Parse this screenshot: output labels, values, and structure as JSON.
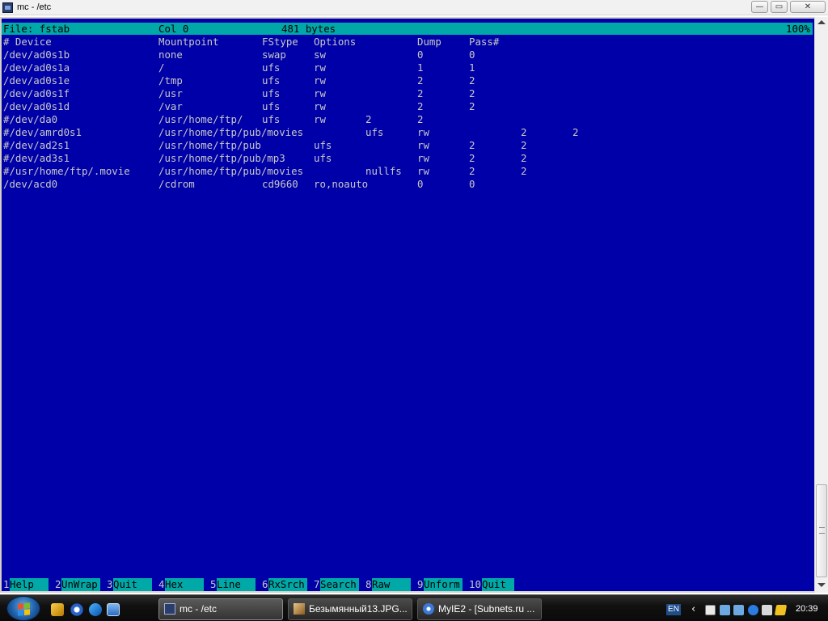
{
  "window": {
    "title": "mc - /etc",
    "minimize_glyph": "—",
    "maximize_glyph": "▭",
    "close_glyph": "✕"
  },
  "status": {
    "file": "File: fstab",
    "col": "Col 0",
    "size": "481 bytes",
    "percent": "100%"
  },
  "fstab": {
    "rows": [
      {
        "cells": [
          {
            "t": "# Device",
            "c": 0
          },
          {
            "t": "Mountpoint",
            "c": 24
          },
          {
            "t": "FStype",
            "c": 40
          },
          {
            "t": "Options",
            "c": 48
          },
          {
            "t": "Dump",
            "c": 64
          },
          {
            "t": "Pass#",
            "c": 72
          }
        ]
      },
      {
        "cells": [
          {
            "t": "/dev/ad0s1b",
            "c": 0
          },
          {
            "t": "none",
            "c": 24
          },
          {
            "t": "swap",
            "c": 40
          },
          {
            "t": "sw",
            "c": 48
          },
          {
            "t": "0",
            "c": 64
          },
          {
            "t": "0",
            "c": 72
          }
        ]
      },
      {
        "cells": [
          {
            "t": "/dev/ad0s1a",
            "c": 0
          },
          {
            "t": "/",
            "c": 24
          },
          {
            "t": "ufs",
            "c": 40
          },
          {
            "t": "rw",
            "c": 48
          },
          {
            "t": "1",
            "c": 64
          },
          {
            "t": "1",
            "c": 72
          }
        ]
      },
      {
        "cells": [
          {
            "t": "/dev/ad0s1e",
            "c": 0
          },
          {
            "t": "/tmp",
            "c": 24
          },
          {
            "t": "ufs",
            "c": 40
          },
          {
            "t": "rw",
            "c": 48
          },
          {
            "t": "2",
            "c": 64
          },
          {
            "t": "2",
            "c": 72
          }
        ]
      },
      {
        "cells": [
          {
            "t": "/dev/ad0s1f",
            "c": 0
          },
          {
            "t": "/usr",
            "c": 24
          },
          {
            "t": "ufs",
            "c": 40
          },
          {
            "t": "rw",
            "c": 48
          },
          {
            "t": "2",
            "c": 64
          },
          {
            "t": "2",
            "c": 72
          }
        ]
      },
      {
        "cells": [
          {
            "t": "/dev/ad0s1d",
            "c": 0
          },
          {
            "t": "/var",
            "c": 24
          },
          {
            "t": "ufs",
            "c": 40
          },
          {
            "t": "rw",
            "c": 48
          },
          {
            "t": "2",
            "c": 64
          },
          {
            "t": "2",
            "c": 72
          }
        ]
      },
      {
        "cells": [
          {
            "t": "#/dev/da0",
            "c": 0
          },
          {
            "t": "/usr/home/ftp/",
            "c": 24
          },
          {
            "t": "ufs",
            "c": 40
          },
          {
            "t": "rw",
            "c": 48
          },
          {
            "t": "2",
            "c": 56
          },
          {
            "t": "2",
            "c": 64
          }
        ]
      },
      {
        "cells": [
          {
            "t": "#/dev/amrd0s1",
            "c": 0
          },
          {
            "t": "/usr/home/ftp/pub/movies",
            "c": 24
          },
          {
            "t": "ufs",
            "c": 56
          },
          {
            "t": "rw",
            "c": 64
          },
          {
            "t": "2",
            "c": 80
          },
          {
            "t": "2",
            "c": 88
          }
        ]
      },
      {
        "cells": [
          {
            "t": "#/dev/ad2s1",
            "c": 0
          },
          {
            "t": "/usr/home/ftp/pub",
            "c": 24
          },
          {
            "t": "ufs",
            "c": 48
          },
          {
            "t": "rw",
            "c": 64
          },
          {
            "t": "2",
            "c": 72
          },
          {
            "t": "2",
            "c": 80
          }
        ]
      },
      {
        "cells": [
          {
            "t": "#/dev/ad3s1",
            "c": 0
          },
          {
            "t": "/usr/home/ftp/pub/mp3",
            "c": 24
          },
          {
            "t": "ufs",
            "c": 48
          },
          {
            "t": "rw",
            "c": 64
          },
          {
            "t": "2",
            "c": 72
          },
          {
            "t": "2",
            "c": 80
          }
        ]
      },
      {
        "cells": [
          {
            "t": "#/usr/home/ftp/.movie",
            "c": 0
          },
          {
            "t": "/usr/home/ftp/pub/movies",
            "c": 24
          },
          {
            "t": "nullfs",
            "c": 56
          },
          {
            "t": "rw",
            "c": 64
          },
          {
            "t": "2",
            "c": 72
          },
          {
            "t": "2",
            "c": 80
          }
        ]
      },
      {
        "cells": [
          {
            "t": "/dev/acd0",
            "c": 0
          },
          {
            "t": "/cdrom",
            "c": 24
          },
          {
            "t": "cd9660",
            "c": 40
          },
          {
            "t": "ro,noauto",
            "c": 48
          },
          {
            "t": "0",
            "c": 64
          },
          {
            "t": "0",
            "c": 72
          }
        ]
      }
    ]
  },
  "fkeys": [
    {
      "num": "1",
      "label": "Help"
    },
    {
      "num": "2",
      "label": "UnWrap"
    },
    {
      "num": "3",
      "label": "Quit"
    },
    {
      "num": "4",
      "label": "Hex"
    },
    {
      "num": "5",
      "label": "Line"
    },
    {
      "num": "6",
      "label": "RxSrch"
    },
    {
      "num": "7",
      "label": "Search"
    },
    {
      "num": "8",
      "label": "Raw"
    },
    {
      "num": "9",
      "label": "Unform"
    },
    {
      "num": "10",
      "label": "Quit"
    }
  ],
  "taskbar": {
    "tasks": [
      {
        "label": "mc - /etc",
        "icon": "terminal-icon"
      },
      {
        "label": "Безымянный13.JPG...",
        "icon": "image-icon"
      },
      {
        "label": "MyIE2 - [Subnets.ru ...",
        "icon": "browser-icon"
      }
    ],
    "language": "EN",
    "tray_arrow": "‹",
    "clock": "20:39"
  }
}
